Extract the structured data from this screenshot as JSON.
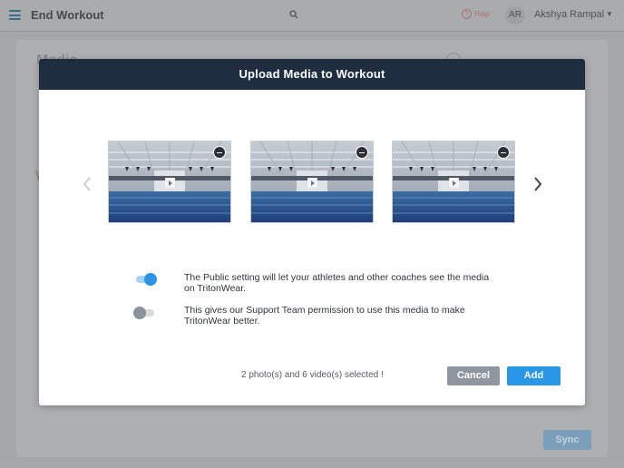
{
  "header": {
    "title": "End Workout",
    "help_label": "Help",
    "avatar_initials": "AR",
    "user_name": "Akshya Rampal"
  },
  "background": {
    "media_title": "Media",
    "section_letter": "W",
    "sync_label": "Sync"
  },
  "modal": {
    "title": "Upload Media to Workout",
    "media_items": [
      {
        "type": "video"
      },
      {
        "type": "video"
      },
      {
        "type": "video"
      }
    ],
    "settings": [
      {
        "enabled": true,
        "text": "The Public setting will let your athletes and other coaches see the media on TritonWear."
      },
      {
        "enabled": false,
        "text": "This gives our Support Team permission to use this media to make TritonWear better."
      }
    ],
    "selection_summary": "2 photo(s) and 6 video(s) selected !",
    "cancel_label": "Cancel",
    "add_label": "Add"
  },
  "colors": {
    "modal_header": "#1e2d3f",
    "primary": "#2a97e6",
    "cancel": "#8e979f"
  }
}
